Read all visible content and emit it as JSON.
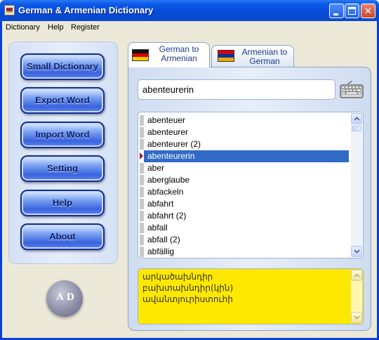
{
  "window": {
    "title": "German & Armenian Dictionary"
  },
  "menu": [
    "Dictionary",
    "Help",
    "Register"
  ],
  "sidebar": {
    "buttons": [
      "Small Dictionary",
      "Export Word",
      "Import Word",
      "Setting",
      "Help",
      "About"
    ]
  },
  "logo": {
    "letters": [
      "A",
      "D"
    ]
  },
  "tabs": [
    {
      "label_line1": "German to",
      "label_line2": "Armenian",
      "flag": "german-flag-icon",
      "active": true
    },
    {
      "label_line1": "Armenian to",
      "label_line2": "German",
      "flag": "armenian-flag-icon",
      "active": false
    }
  ],
  "search": {
    "value": "abenteurerin",
    "placeholder": ""
  },
  "word_list": {
    "items": [
      "abenteuer",
      "abenteurer",
      "abenteurer (2)",
      "abenteurerin",
      "aber",
      "aberglaube",
      "abfackeln",
      "abfahrt",
      "abfahrt (2)",
      "abfall",
      "abfall (2)",
      "abfällig"
    ],
    "selected_index": 3
  },
  "translation": {
    "lines": [
      "արկածախնդիր",
      "բախտախնդիր(կին)",
      "ավանտյուրիստուհի"
    ]
  },
  "colors": {
    "title_bar": "#0549d8",
    "selection": "#316ac5",
    "translation_bg": "#ffe800",
    "nav_button": "#3a63de"
  }
}
